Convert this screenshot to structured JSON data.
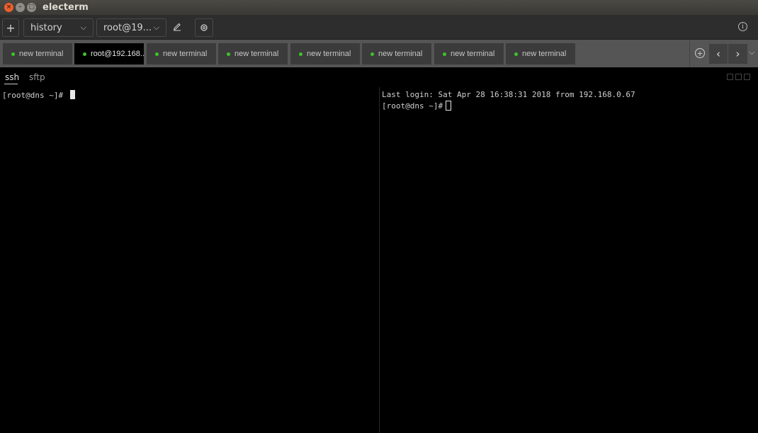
{
  "window": {
    "title": "electerm"
  },
  "toolbar": {
    "add_label": "+",
    "history_label": "history",
    "host_label": "root@19...",
    "chevron": "⌵",
    "edit_icon": "pencil-icon",
    "settings_icon": "gear-icon",
    "info_icon": "info-icon"
  },
  "tabs": [
    {
      "label": "new terminal",
      "status_color": "#3fc22b"
    },
    {
      "label": "root@192.168....",
      "status_color": "#3fc22b",
      "active": true
    },
    {
      "label": "new terminal",
      "status_color": "#3fc22b"
    },
    {
      "label": "new terminal",
      "status_color": "#3fc22b"
    },
    {
      "label": "new terminal",
      "status_color": "#3fc22b"
    },
    {
      "label": "new terminal",
      "status_color": "#3fc22b"
    },
    {
      "label": "new terminal",
      "status_color": "#3fc22b"
    },
    {
      "label": "new terminal",
      "status_color": "#3fc22b"
    }
  ],
  "session_tabs": {
    "ssh": "ssh",
    "sftp": "sftp"
  },
  "terminals": {
    "left": {
      "prompt": "[root@dns ~]# "
    },
    "right": {
      "last_login": "Last login: Sat Apr 28 16:38:31 2018 from 192.168.0.67",
      "prompt": "[root@dns ~]#"
    }
  }
}
